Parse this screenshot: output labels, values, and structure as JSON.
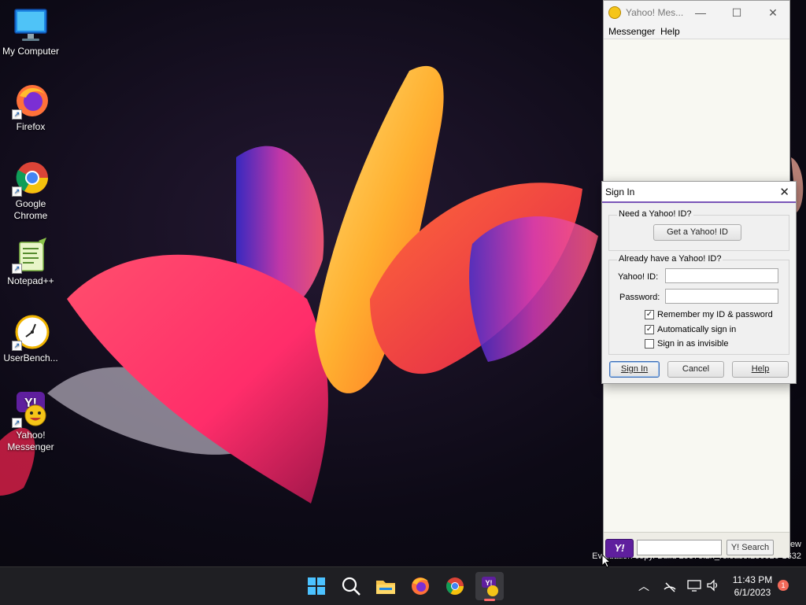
{
  "desktop": {
    "icons": [
      {
        "label": "My Computer"
      },
      {
        "label": "Firefox"
      },
      {
        "label": "Google Chrome"
      },
      {
        "label": "Notepad++"
      },
      {
        "label": "UserBench..."
      },
      {
        "label": "Yahoo! Messenger"
      }
    ],
    "watermark_line1": "ew",
    "watermark_line2": "Evaluation copy. Build 25375.zn_release.230520-1632"
  },
  "ym_window": {
    "title": "Yahoo! Mes...",
    "menu": [
      "Messenger",
      "Help"
    ],
    "search_button": "Y! Search",
    "logo": "Y!"
  },
  "signin_dialog": {
    "title": "Sign In",
    "group_new": "Need a Yahoo! ID?",
    "get_id_button": "Get a Yahoo! ID",
    "group_existing": "Already have a Yahoo! ID?",
    "yahoo_id_label": "Yahoo! ID:",
    "yahoo_id_value": "",
    "password_label": "Password:",
    "password_value": "",
    "remember_label": "Remember my ID & password",
    "remember_checked": true,
    "auto_label": "Automatically sign in",
    "auto_checked": true,
    "invisible_label": "Sign in as invisible",
    "invisible_checked": false,
    "signin_button": "Sign In",
    "cancel_button": "Cancel",
    "help_button": "Help"
  },
  "taskbar": {
    "apps": [
      "start",
      "search",
      "file-explorer",
      "firefox",
      "chrome",
      "yahoo-messenger"
    ],
    "time": "11:43 PM",
    "date": "6/1/2023",
    "notification_count": "1"
  },
  "colors": {
    "taskbar": "#1f1f23",
    "yahoo_purple": "#5f1f9e",
    "dialog_accent": "#7a55b8"
  }
}
